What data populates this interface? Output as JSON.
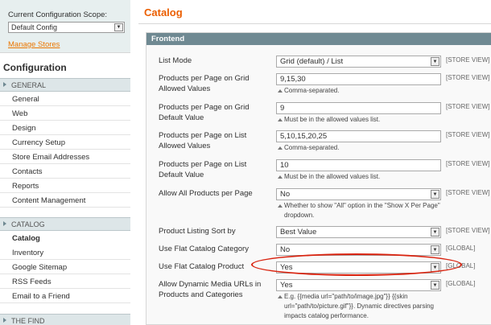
{
  "sidebar": {
    "scope_label": "Current Configuration Scope:",
    "scope_value": "Default Config",
    "manage_stores": "Manage Stores",
    "config_title": "Configuration",
    "sections": [
      {
        "title": "GENERAL",
        "items": [
          "General",
          "Web",
          "Design",
          "Currency Setup",
          "Store Email Addresses",
          "Contacts",
          "Reports",
          "Content Management"
        ]
      },
      {
        "title": "CATALOG",
        "items": [
          "Catalog",
          "Inventory",
          "Google Sitemap",
          "RSS Feeds",
          "Email to a Friend"
        ],
        "active": "Catalog"
      },
      {
        "title": "THE FIND",
        "items": []
      }
    ]
  },
  "main": {
    "title": "Catalog",
    "fieldset_title": "Frontend",
    "rows": [
      {
        "label": "List Mode",
        "type": "select",
        "value": "Grid (default) / List",
        "scope": "[STORE VIEW]",
        "note": ""
      },
      {
        "label": "Products per Page on Grid Allowed Values",
        "type": "text",
        "value": "9,15,30",
        "scope": "[STORE VIEW]",
        "note": "Comma-separated."
      },
      {
        "label": "Products per Page on Grid Default Value",
        "type": "text",
        "value": "9",
        "scope": "[STORE VIEW]",
        "note": "Must be in the allowed values list."
      },
      {
        "label": "Products per Page on List Allowed Values",
        "type": "text",
        "value": "5,10,15,20,25",
        "scope": "[STORE VIEW]",
        "note": "Comma-separated."
      },
      {
        "label": "Products per Page on List Default Value",
        "type": "text",
        "value": "10",
        "scope": "[STORE VIEW]",
        "note": "Must be in the allowed values list."
      },
      {
        "label": "Allow All Products per Page",
        "type": "select",
        "value": "No",
        "scope": "[STORE VIEW]",
        "note": "Whether to show \"All\" option in the \"Show X Per Page\" dropdown."
      },
      {
        "label": "Product Listing Sort by",
        "type": "select",
        "value": "Best Value",
        "scope": "[STORE VIEW]",
        "note": ""
      },
      {
        "label": "Use Flat Catalog Category",
        "type": "select",
        "value": "No",
        "scope": "[GLOBAL]",
        "note": ""
      },
      {
        "label": "Use Flat Catalog Product",
        "type": "select",
        "value": "Yes",
        "scope": "[GLOBAL]",
        "note": ""
      },
      {
        "label": "Allow Dynamic Media URLs in Products and Categories",
        "type": "select",
        "value": "Yes",
        "scope": "[GLOBAL]",
        "note": "E.g. {{media url=\"path/to/image.jpg\"}} {{skin url=\"path/to/picture.gif\"}}. Dynamic directives parsing impacts catalog performance."
      }
    ]
  },
  "colors": {
    "accent": "#eb5e00",
    "section_header": "#6f8992",
    "highlight": "#d9230f"
  }
}
